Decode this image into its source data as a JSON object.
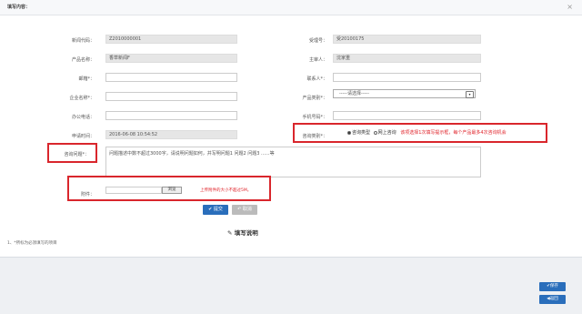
{
  "dialog": {
    "title": "填写内容：",
    "close": "×"
  },
  "form": {
    "row1": {
      "label_left": "新闻代码：",
      "value_left": "Z2010000001",
      "label_right": "受理号：",
      "value_right": "受20100175"
    },
    "row2": {
      "label_left": "产品名称：",
      "value_left": "香草新闻F",
      "label_right": "主审人：",
      "value_right": "沈家重"
    },
    "row3": {
      "label_left": "邮箱*：",
      "label_right": "联系人*："
    },
    "row4": {
      "label_left": "企业名称*：",
      "label_right": "产品类别*：",
      "select_value": "-----请选择-----"
    },
    "row5": {
      "label_left": "办公电话：",
      "label_right": "手机号码*："
    },
    "row6": {
      "label_left": "申请时间：",
      "value_left": "2016-06-08 10:54:52",
      "label_right": "咨询类别*：",
      "radio1": "咨询类型",
      "radio2": "网上咨询",
      "hint": "该项选择1次填写提示框，每个产品最多4次咨询机会"
    },
    "question": {
      "label": "咨询问题*：",
      "text": "问题描述中数不超过3000字，请说明问题如何，并写明问题1 问题2 问题3 ......等"
    },
    "attachment": {
      "label": "附件：",
      "browse": "浏览",
      "hint": "上传附件的大小不超过5M。"
    }
  },
  "buttons": {
    "submit": "提交",
    "reset": "取消"
  },
  "instructions": {
    "title": "填写说明",
    "note": "1、*所标为必须填写的项目"
  },
  "footer_buttons": {
    "save": "保存",
    "back": "返回"
  }
}
